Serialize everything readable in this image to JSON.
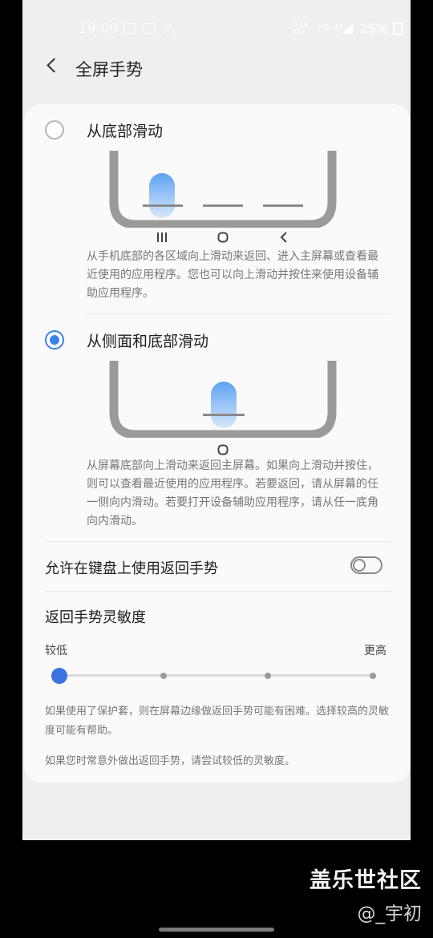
{
  "status_bar": {
    "time": "19:09",
    "icons_left": [
      "image-icon",
      "gmail-icon",
      "network-icon"
    ],
    "speed": "0.14 K/s",
    "network": "HD",
    "signal": "4G",
    "battery": "25%"
  },
  "header": {
    "title": "全屏手势"
  },
  "options": [
    {
      "label": "从底部滑动",
      "selected": false,
      "description": "从手机底部的各区域向上滑动来返回、进入主屏幕或查看最近使用的应用程序。您也可以向上滑动并按住来使用设备辅助应用程序。",
      "nav_icons": [
        "recent-apps-icon",
        "home-icon",
        "back-icon"
      ]
    },
    {
      "label": "从侧面和底部滑动",
      "selected": true,
      "description": "从屏幕底部向上滑动来返回主屏幕。如果向上滑动并按住，则可以查看最近使用的应用程序。若要返回，请从屏幕的任一侧向内滑动。若要打开设备辅助应用程序，请从任一底角向内滑动。",
      "nav_icons": [
        "home-icon"
      ]
    }
  ],
  "keyboard_gesture": {
    "label": "允许在键盘上使用返回手势",
    "enabled": false
  },
  "sensitivity": {
    "title": "返回手势灵敏度",
    "low_label": "较低",
    "high_label": "更高",
    "steps": 4,
    "value_index": 0,
    "note1": "如果使用了保护套，则在屏幕边缘做返回手势可能有困难。选择较高的灵敏度可能有帮助。",
    "note2": "如果您时常意外做出返回手势，请尝试较低的灵敏度。"
  },
  "watermark": {
    "line1": "盖乐世社区",
    "line2": "@_宇初"
  },
  "colors": {
    "accent": "#3b82e8",
    "card_bg": "#fafafa",
    "screen_bg": "#efefef"
  }
}
